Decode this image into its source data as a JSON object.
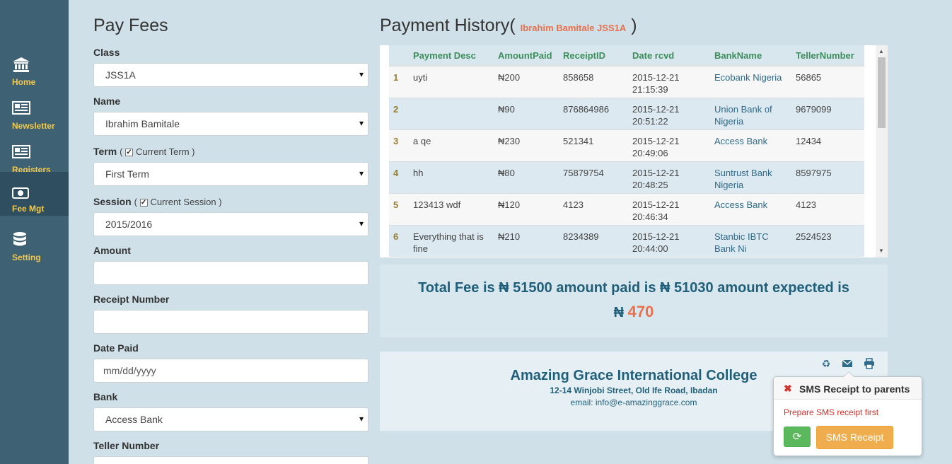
{
  "sidebar": {
    "items": [
      {
        "label": "Home",
        "icon": "bank-icon"
      },
      {
        "label": "Newsletter",
        "icon": "newspaper-icon"
      },
      {
        "label": "Registers",
        "icon": "newspaper-icon"
      },
      {
        "label": "Fee Mgt",
        "icon": "money-icon",
        "active": true
      },
      {
        "label": "Setting",
        "icon": "database-icon"
      }
    ]
  },
  "form": {
    "title": "Pay Fees",
    "class_label": "Class",
    "class_value": "JSS1A",
    "name_label": "Name",
    "name_value": "Ibrahim Bamitale",
    "term_label": "Term",
    "term_check_label": "Current Term",
    "term_value": "First Term",
    "session_label": "Session",
    "session_check_label": "Current Session",
    "session_value": "2015/2016",
    "amount_label": "Amount",
    "amount_value": "",
    "receipt_label": "Receipt Number",
    "receipt_value": "",
    "date_label": "Date Paid",
    "date_placeholder": "mm/dd/yyyy",
    "bank_label": "Bank",
    "bank_value": "Access Bank",
    "teller_label": "Teller Number"
  },
  "history": {
    "title": "Payment History(",
    "title_close": ")",
    "student": "Ibrahim Bamitale JSS1A",
    "columns": [
      "Payment Desc",
      "AmountPaid",
      "ReceiptID",
      "Date rcvd",
      "BankName",
      "TellerNumber"
    ],
    "rows": [
      {
        "n": "1",
        "desc": "uyti",
        "amount": "₦200",
        "receipt": "858658",
        "date": "2015-12-21",
        "time": "21:15:39",
        "bank1": "Ecobank Nigeria",
        "bank2": "",
        "teller": "56865"
      },
      {
        "n": "2",
        "desc": "",
        "amount": "₦90",
        "receipt": "876864986",
        "date": "2015-12-21",
        "time": "20:51:22",
        "bank1": "Union Bank of",
        "bank2": "Nigeria",
        "teller": "9679099"
      },
      {
        "n": "3",
        "desc": "a qe",
        "amount": "₦230",
        "receipt": "521341",
        "date": "2015-12-21",
        "time": "20:49:06",
        "bank1": "Access Bank",
        "bank2": "",
        "teller": "12434"
      },
      {
        "n": "4",
        "desc": "hh",
        "amount": "₦80",
        "receipt": "75879754",
        "date": "2015-12-21",
        "time": "20:48:25",
        "bank1": "Suntrust Bank",
        "bank2": "Nigeria",
        "teller": "8597975"
      },
      {
        "n": "5",
        "desc": "123413 wdf",
        "amount": "₦120",
        "receipt": "4123",
        "date": "2015-12-21",
        "time": "20:46:34",
        "bank1": "Access Bank",
        "bank2": "",
        "teller": "4123"
      },
      {
        "n": "6",
        "desc": "Everything that is",
        "desc2": "fine",
        "amount": "₦210",
        "receipt": "8234389",
        "date": "2015-12-21",
        "time": "20:44:00",
        "bank1": "Stanbic IBTC",
        "bank2": "Bank Ni",
        "teller": "2524523"
      }
    ]
  },
  "totals": {
    "line1": "Total Fee is ₦ 51500 amount paid is ₦ 51030 amount expected is",
    "currency": "₦",
    "expected": "470"
  },
  "receipt": {
    "college": "Amazing Grace International College",
    "address": "12-14 Winjobi Street, Old Ife Road, Ibadan",
    "email": "email: info@e-amazinggrace.com"
  },
  "popover": {
    "title": "SMS Receipt to parents",
    "message": "Prepare SMS receipt first",
    "sms_button": "SMS Receipt"
  }
}
